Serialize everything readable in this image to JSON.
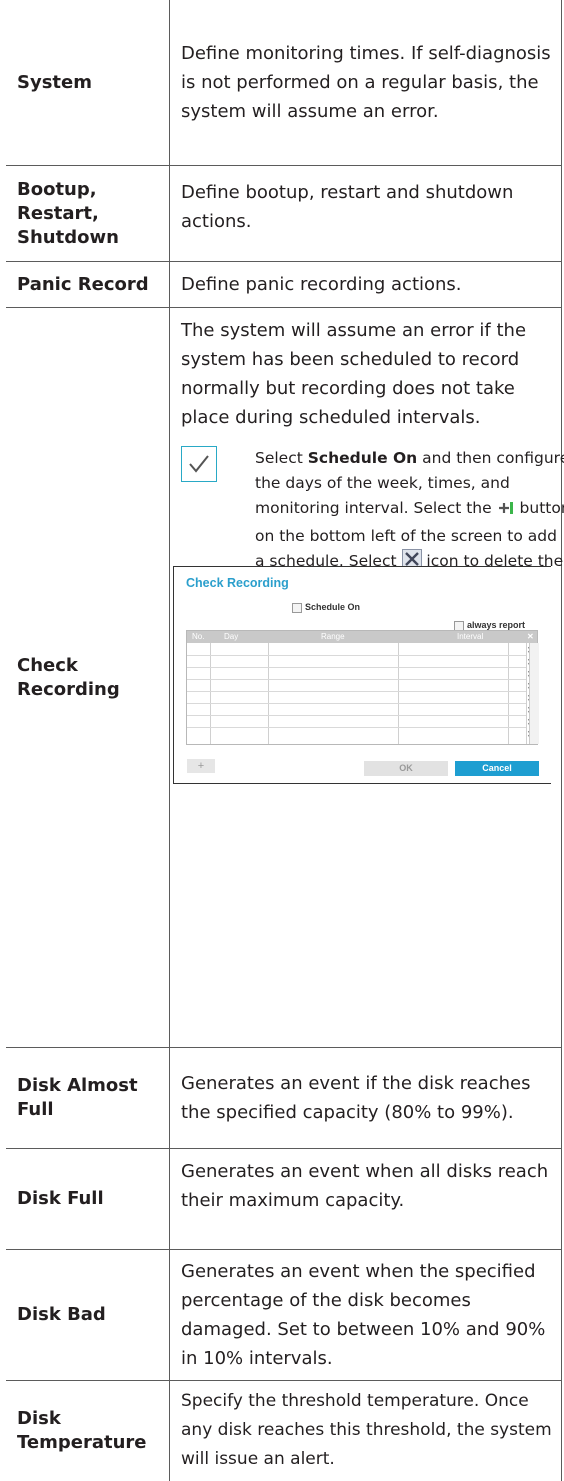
{
  "rows": [
    {
      "label": "System",
      "desc": "Define monitoring times. If self-diagnosis is not performed on a regular basis, the system will assume an error."
    },
    {
      "label": "Bootup, Restart, Shutdown",
      "desc": "Define bootup, restart and shutdown actions."
    },
    {
      "label": "Panic Record",
      "desc": "Define panic recording actions."
    },
    {
      "label": "Check Recording",
      "desc": "The system will assume an error if the system has been scheduled to record normally but recording does not take place during scheduled intervals."
    },
    {
      "label": "Disk Almost Full",
      "desc": "Generates an event if the disk reaches the specified capacity (80% to 99%)."
    },
    {
      "label": "Disk Full",
      "desc": "Generates an event when all disks reach their maximum capacity."
    },
    {
      "label": "Disk Bad",
      "desc": "Generates an event when the specified percentage of the disk becomes damaged. Set to between 10% and 90% in 10% intervals."
    },
    {
      "label": "Disk Temperature",
      "desc": "Specify the threshold temperature. Once any disk reaches this threshold, the system will issue an alert."
    }
  ],
  "note": {
    "p1": "Select ",
    "p1_bold": "Schedule On",
    "p2": " and then configure the days of the week, times, and monitoring interval. Select the ",
    "p3": " button on the bottom left of the screen to add a schedule. Select ",
    "p4": " icon to delete the schedule.",
    "icon": "check-icon",
    "accent": "#29a9c6"
  },
  "dialog": {
    "title": "Check Recording",
    "schedule_on": "Schedule On",
    "always_report": "always report",
    "columns": [
      "No.",
      "Day",
      "Range",
      "Interval"
    ],
    "ok": "OK",
    "cancel": "Cancel",
    "add": "+",
    "accent": "#2b9fcc"
  }
}
